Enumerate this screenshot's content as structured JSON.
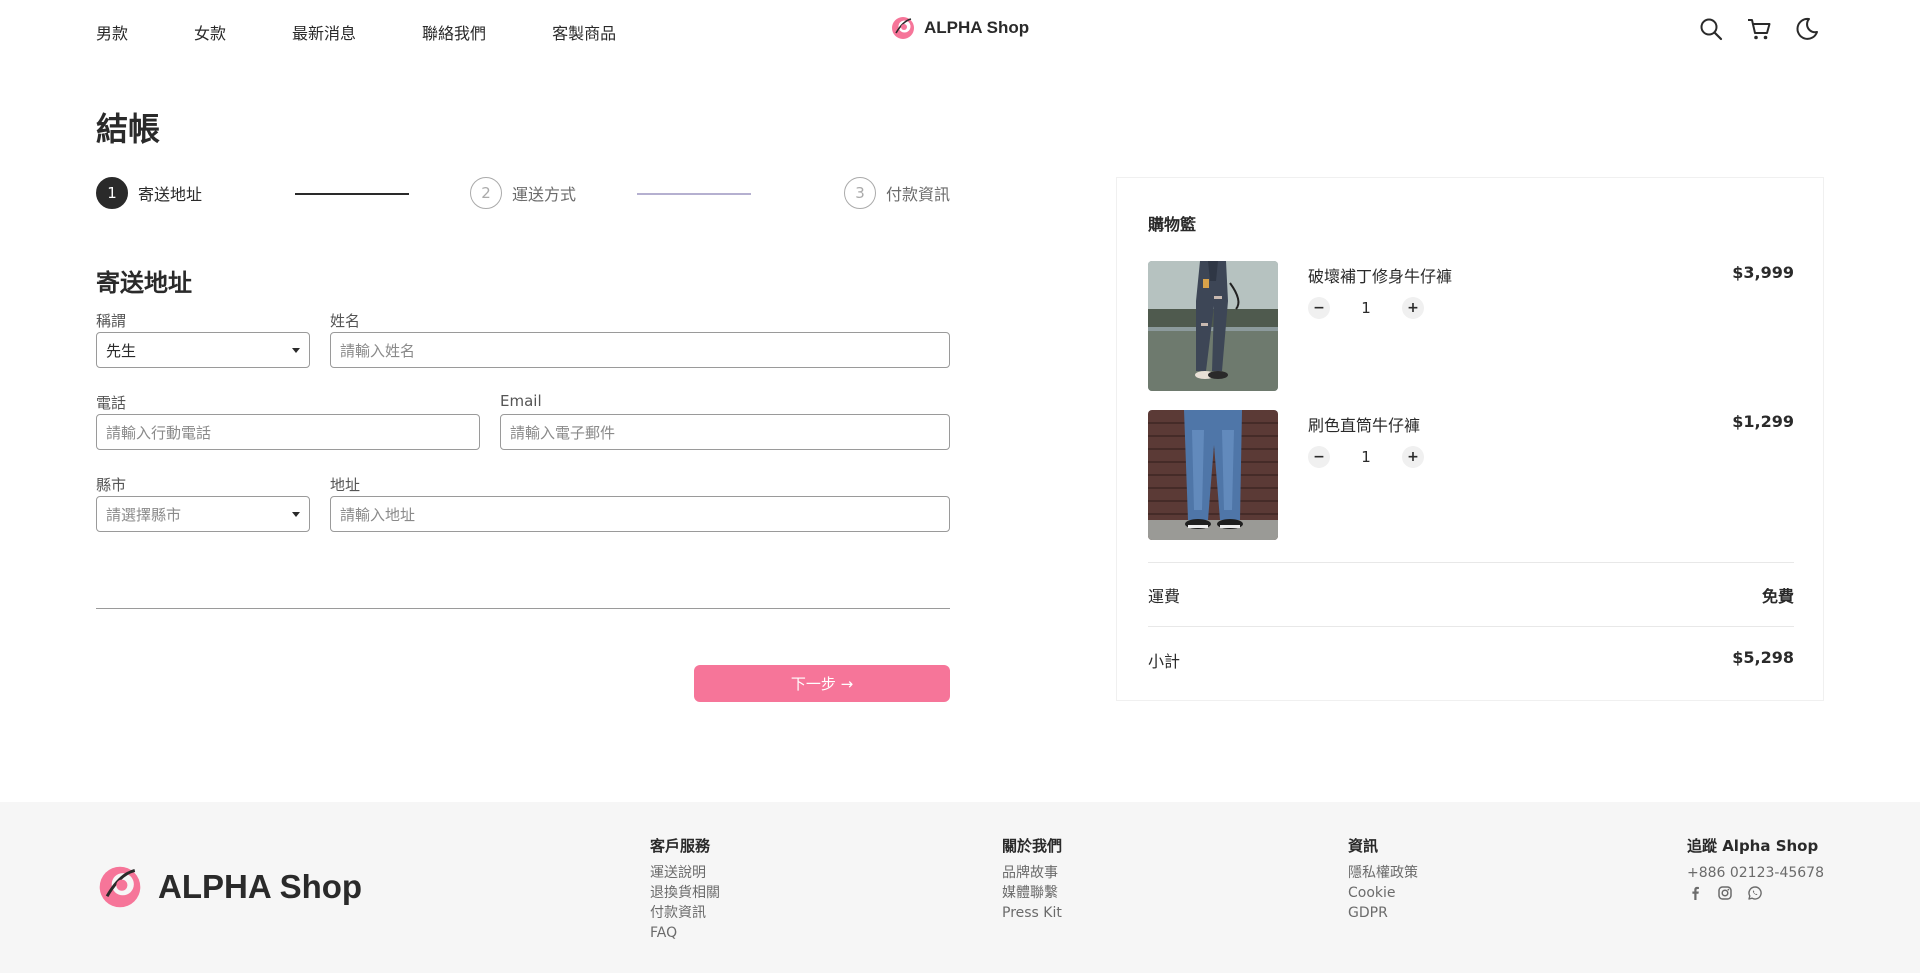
{
  "header": {
    "nav": [
      "男款",
      "女款",
      "最新消息",
      "聯絡我們",
      "客製商品"
    ],
    "brand": "ALPHA Shop",
    "icons": [
      "search-icon",
      "cart-icon",
      "moon-icon"
    ]
  },
  "checkout": {
    "title": "結帳",
    "steps": [
      {
        "num": "1",
        "label": "寄送地址",
        "state": "active"
      },
      {
        "num": "2",
        "label": "運送方式",
        "state": "pending"
      },
      {
        "num": "3",
        "label": "付款資訊",
        "state": "pending"
      }
    ]
  },
  "form": {
    "title": "寄送地址",
    "salutation": {
      "label": "稱謂",
      "value": "先生"
    },
    "name": {
      "label": "姓名",
      "placeholder": "請輸入姓名"
    },
    "phone": {
      "label": "電話",
      "placeholder": "請輸入行動電話"
    },
    "email": {
      "label": "Email",
      "placeholder": "請輸入電子郵件"
    },
    "city": {
      "label": "縣市",
      "placeholder": "請選擇縣市"
    },
    "address": {
      "label": "地址",
      "placeholder": "請輸入地址"
    },
    "next_label": "下一步 →"
  },
  "cart": {
    "title": "購物籃",
    "items": [
      {
        "name": "破壞補丁修身牛仔褲",
        "price": "$3,999",
        "qty": "1"
      },
      {
        "name": "刷色直筒牛仔褲",
        "price": "$1,299",
        "qty": "1"
      }
    ],
    "shipping_label": "運費",
    "shipping_value": "免費",
    "subtotal_label": "小計",
    "subtotal_value": "$5,298"
  },
  "footer": {
    "brand": "ALPHA Shop",
    "columns": [
      {
        "title": "客戶服務",
        "links": [
          "運送說明",
          "退換貨相關",
          "付款資訊",
          "FAQ"
        ]
      },
      {
        "title": "關於我們",
        "links": [
          "品牌故事",
          "媒體聯繫",
          "Press Kit"
        ]
      },
      {
        "title": "資訊",
        "links": [
          "隱私權政策",
          "Cookie",
          "GDPR"
        ]
      }
    ],
    "follow": {
      "title": "追蹤 Alpha Shop",
      "phone": "+886 02123-45678",
      "icons": [
        "facebook-icon",
        "instagram-icon",
        "whatsapp-icon"
      ]
    }
  },
  "colors": {
    "accent": "#f67599",
    "dark": "#2a2a2a",
    "line": "#b5b0d0"
  }
}
